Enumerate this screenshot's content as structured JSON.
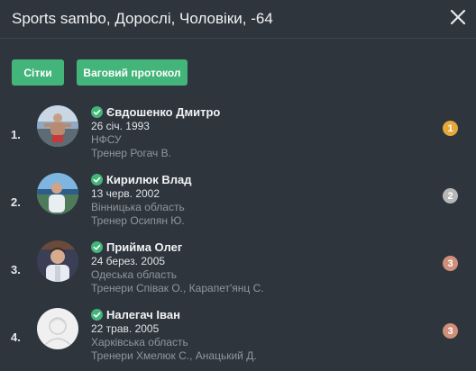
{
  "header": {
    "title": "Sports sambo, Дорослі, Чоловіки, -64"
  },
  "actions": {
    "grids_label": "Сітки",
    "protocol_label": "Ваговий протокол"
  },
  "colors": {
    "background": "#2e353d",
    "accent": "#43b57a",
    "gold": "#e5a93a",
    "silver": "#b7b7b7",
    "bronze": "#d08f7a"
  },
  "participants": [
    {
      "rank": "1.",
      "name": "Євдошенко Дмитро",
      "dob": "26 січ. 1993",
      "org": "НФСУ",
      "coach": "Тренер Рогач В.",
      "medal": "1",
      "avatar_icon": "athlete-photo",
      "verified_icon": "check-circle-icon"
    },
    {
      "rank": "2.",
      "name": "Кирилюк Влад",
      "dob": "13 черв. 2002",
      "org": "Вінницька область",
      "coach": "Тренер Осипян Ю.",
      "medal": "2",
      "avatar_icon": "athlete-photo",
      "verified_icon": "check-circle-icon"
    },
    {
      "rank": "3.",
      "name": "Прийма Олег",
      "dob": "24 берез. 2005",
      "org": "Одеська область",
      "coach": "Тренери Співак О.,  Карапет'янц С.",
      "medal": "3",
      "avatar_icon": "athlete-photo",
      "verified_icon": "check-circle-icon"
    },
    {
      "rank": "4.",
      "name": "Налегач Іван",
      "dob": "22 трав. 2005",
      "org": "Харківська область",
      "coach": "Тренери Хмелюк С.,  Анацький Д.",
      "medal": "3",
      "avatar_icon": "default-avatar-icon",
      "verified_icon": "check-circle-icon"
    }
  ]
}
